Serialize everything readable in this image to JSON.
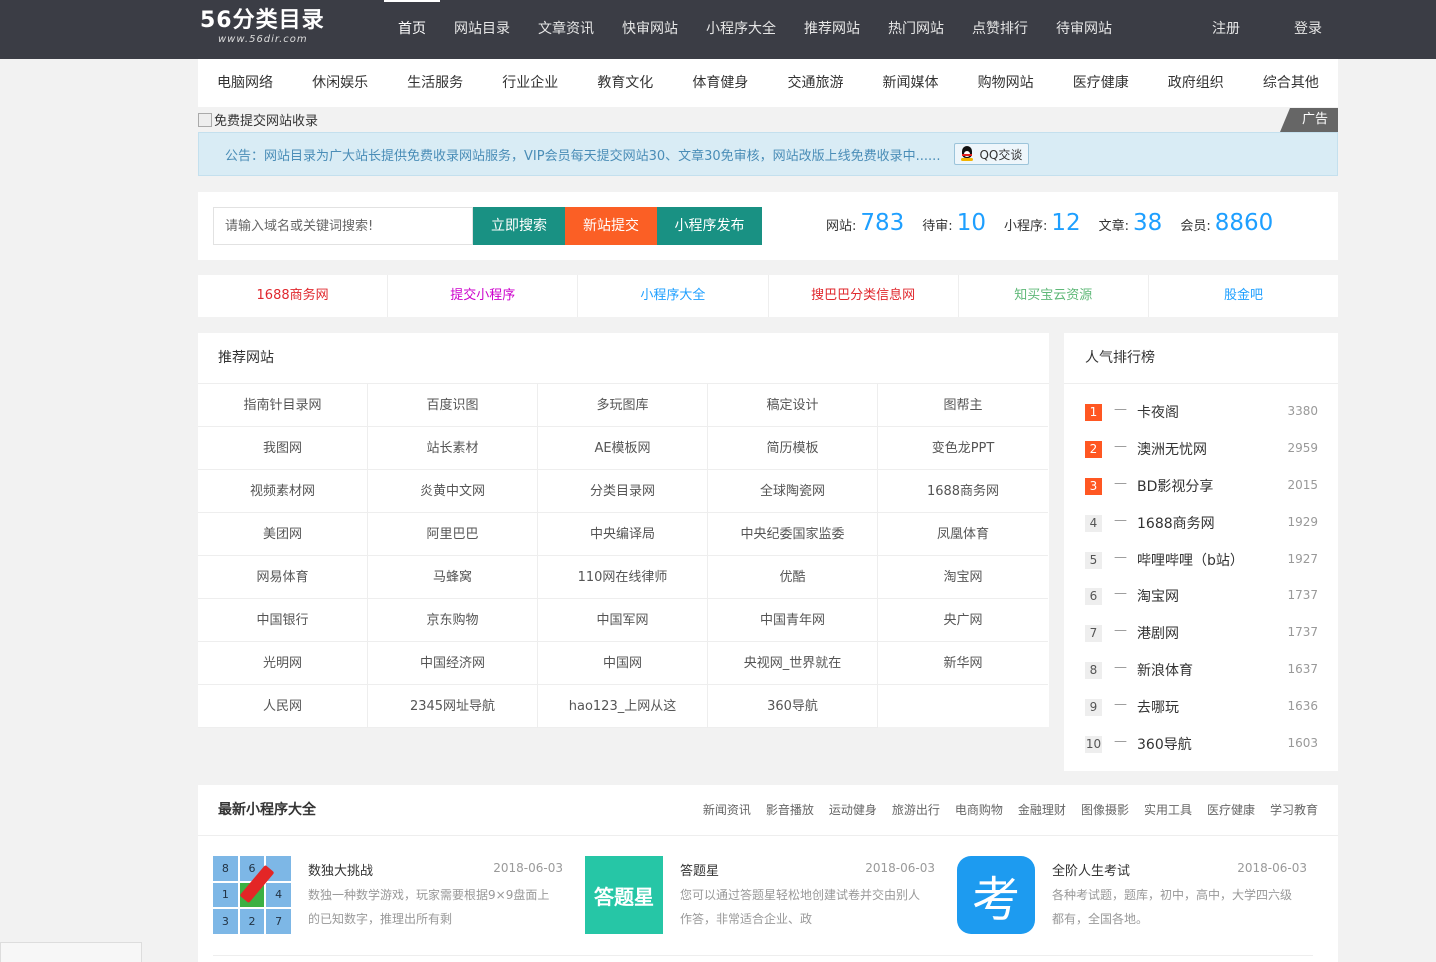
{
  "logo": {
    "main": "56分类目录",
    "sub": "www.56dir.com"
  },
  "nav": [
    "首页",
    "网站目录",
    "文章资讯",
    "快审网站",
    "小程序大全",
    "推荐网站",
    "热门网站",
    "点赞排行",
    "待审网站"
  ],
  "auth": {
    "register": "注册",
    "login": "登录"
  },
  "categories": [
    "电脑网络",
    "休闲娱乐",
    "生活服务",
    "行业企业",
    "教育文化",
    "体育健身",
    "交通旅游",
    "新闻媒体",
    "购物网站",
    "医疗健康",
    "政府组织",
    "综合其他"
  ],
  "ad": {
    "alt": "免费提交网站收录",
    "tag": "广告"
  },
  "notice": {
    "text": "公告：网站目录为广大站长提供免费收录网站服务，VIP会员每天提交网站30、文章30免审核，网站改版上线免费收录中......",
    "qq": "QQ交谈"
  },
  "search": {
    "placeholder": "请输入域名或关键词搜索!",
    "search_btn": "立即搜索",
    "submit_btn": "新站提交",
    "mini_btn": "小程序发布"
  },
  "stats": [
    {
      "label": "网站:",
      "value": "783"
    },
    {
      "label": "待审:",
      "value": "10"
    },
    {
      "label": "小程序:",
      "value": "12"
    },
    {
      "label": "文章:",
      "value": "38"
    },
    {
      "label": "会员:",
      "value": "8860"
    }
  ],
  "quick_links": [
    {
      "label": "1688商务网",
      "color": "#e0282e"
    },
    {
      "label": "提交小程序",
      "color": "#cc00cc"
    },
    {
      "label": "小程序大全",
      "color": "#1e9fff"
    },
    {
      "label": "搜巴巴分类信息网",
      "color": "#e0282e"
    },
    {
      "label": "知买宝云资源",
      "color": "#5fb878"
    },
    {
      "label": "股金吧",
      "color": "#1e9fff"
    }
  ],
  "recommend": {
    "title": "推荐网站",
    "items": [
      "指南针目录网",
      "百度识图",
      "多玩图库",
      "稿定设计",
      "图帮主",
      "我图网",
      "站长素材",
      "AE模板网",
      "简历模板",
      "变色龙PPT",
      "视频素材网",
      "炎黄中文网",
      "分类目录网",
      "全球陶瓷网",
      "1688商务网",
      "美团网",
      "阿里巴巴",
      "中央编译局",
      "中央纪委国家监委",
      "凤凰体育",
      "网易体育",
      "马蜂窝",
      "110网在线律师",
      "优酷",
      "淘宝网",
      "中国银行",
      "京东购物",
      "中国军网",
      "中国青年网",
      "央广网",
      "光明网",
      "中国经济网",
      "中国网",
      "央视网_世界就在",
      "新华网",
      "人民网",
      "2345网址导航",
      "hao123_上网从这",
      "360导航"
    ]
  },
  "ranking": {
    "title": "人气排行榜",
    "dash": "—",
    "items": [
      {
        "rank": "1",
        "name": "卡夜阁",
        "count": "3380"
      },
      {
        "rank": "2",
        "name": "澳洲无忧网",
        "count": "2959"
      },
      {
        "rank": "3",
        "name": "BD影视分享",
        "count": "2015"
      },
      {
        "rank": "4",
        "name": "1688商务网",
        "count": "1929"
      },
      {
        "rank": "5",
        "name": "哔哩哔哩（b站）",
        "count": "1927"
      },
      {
        "rank": "6",
        "name": "淘宝网",
        "count": "1737"
      },
      {
        "rank": "7",
        "name": "港剧网",
        "count": "1737"
      },
      {
        "rank": "8",
        "name": "新浪体育",
        "count": "1637"
      },
      {
        "rank": "9",
        "name": "去哪玩",
        "count": "1636"
      },
      {
        "rank": "10",
        "name": "360导航",
        "count": "1603"
      }
    ]
  },
  "mini": {
    "title": "最新小程序大全",
    "tags": [
      "新闻资讯",
      "影音播放",
      "运动健身",
      "旅游出行",
      "电商购物",
      "金融理财",
      "图像摄影",
      "实用工具",
      "医疗健康",
      "学习教育"
    ],
    "cards": [
      {
        "name": "数独大挑战",
        "date": "2018-06-03",
        "desc": "数独一种数学游戏，玩家需要根据9×9盘面上的已知数字，推理出所有剩",
        "thumb_cells": [
          "8",
          "6",
          "",
          "1",
          "",
          "4",
          "3",
          "2",
          "7"
        ]
      },
      {
        "name": "答题星",
        "date": "2018-06-03",
        "desc": "您可以通过答题星轻松地创建试卷并交由别人作答，非常适合企业、政",
        "thumb_text": "答题星"
      },
      {
        "name": "全阶人生考试",
        "date": "2018-06-03",
        "desc": "各种考试题，题库，初中，高中，大学四六级都有，全国各地。",
        "thumb_text": "考"
      }
    ]
  }
}
